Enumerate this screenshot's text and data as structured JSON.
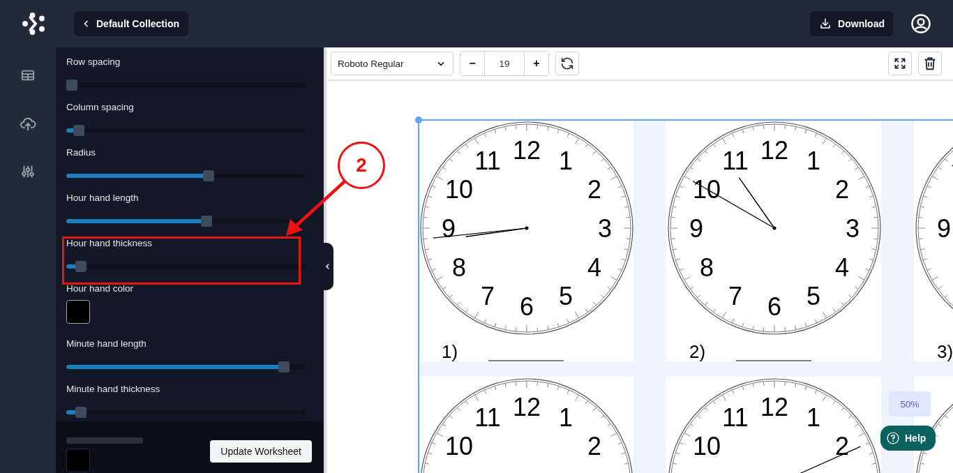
{
  "header": {
    "back_button": "Default Collection",
    "download_button": "Download"
  },
  "settings": [
    {
      "kind": "slider",
      "label": "Row spacing",
      "level": 0
    },
    {
      "kind": "slider",
      "label": "Column spacing",
      "level": 0.03
    },
    {
      "kind": "slider",
      "label": "Radius",
      "level": 0.6
    },
    {
      "kind": "slider",
      "label": "Hour hand length",
      "level": 0.59
    },
    {
      "kind": "slider",
      "label": "Hour hand thickness",
      "level": 0.04
    },
    {
      "kind": "color",
      "label": "Hour hand color"
    },
    {
      "kind": "slider",
      "label": "Minute hand length",
      "level": 0.93
    },
    {
      "kind": "slider",
      "label": "Minute hand thickness",
      "level": 0.04
    }
  ],
  "footer": {
    "button": "Update Worksheet"
  },
  "toolbar": {
    "font": "Roboto Regular",
    "decrease": "−",
    "size": "19",
    "increase": "+"
  },
  "worksheet": {
    "clocks": [
      {
        "kind": "clock",
        "label": "1)",
        "numbers": [
          {
            "kind": "twelve",
            "text": "12"
          },
          {
            "kind": "eleven",
            "text": "11"
          },
          {
            "kind": "one",
            "text": "1"
          },
          {
            "kind": "ten",
            "text": "10"
          },
          {
            "kind": "two",
            "text": "2"
          },
          {
            "kind": "nine",
            "text": "9"
          },
          {
            "kind": "three",
            "text": "3"
          },
          {
            "kind": "eight",
            "text": "8"
          },
          {
            "kind": "four",
            "text": "4"
          },
          {
            "kind": "seven",
            "text": "7"
          },
          {
            "kind": "five",
            "text": "5"
          },
          {
            "kind": "six",
            "text": "6"
          }
        ]
      },
      {
        "kind": "clock",
        "label": "2)",
        "numbers": [
          {
            "kind": "twelve",
            "text": "12"
          },
          {
            "kind": "eleven",
            "text": "11"
          },
          {
            "kind": "one",
            "text": "1"
          },
          {
            "kind": "ten",
            "text": "10"
          },
          {
            "kind": "two",
            "text": "2"
          },
          {
            "kind": "nine",
            "text": "9"
          },
          {
            "kind": "three",
            "text": "3"
          },
          {
            "kind": "eight",
            "text": "8"
          },
          {
            "kind": "four",
            "text": "4"
          },
          {
            "kind": "seven",
            "text": "7"
          },
          {
            "kind": "five",
            "text": "5"
          },
          {
            "kind": "six",
            "text": "6"
          }
        ]
      },
      {
        "kind": "clock",
        "label": "3)",
        "numbers": [
          {
            "kind": "nine",
            "text": "9"
          }
        ]
      },
      {
        "kind": "clock",
        "numbers": [
          {
            "kind": "twelve",
            "text": "12"
          },
          {
            "kind": "eleven",
            "text": "11"
          },
          {
            "kind": "one",
            "text": "1"
          },
          {
            "kind": "ten",
            "text": "10"
          },
          {
            "kind": "two",
            "text": "2"
          }
        ]
      },
      {
        "kind": "clock",
        "numbers": [
          {
            "kind": "twelve",
            "text": "12"
          },
          {
            "kind": "eleven",
            "text": "11"
          },
          {
            "kind": "one",
            "text": "1"
          },
          {
            "kind": "ten",
            "text": "10"
          },
          {
            "kind": "two",
            "text": "2"
          }
        ]
      },
      {
        "kind": "clock"
      }
    ]
  },
  "zoom_badge": "50%",
  "help_button": "Help",
  "annotation": {
    "label": "2"
  }
}
